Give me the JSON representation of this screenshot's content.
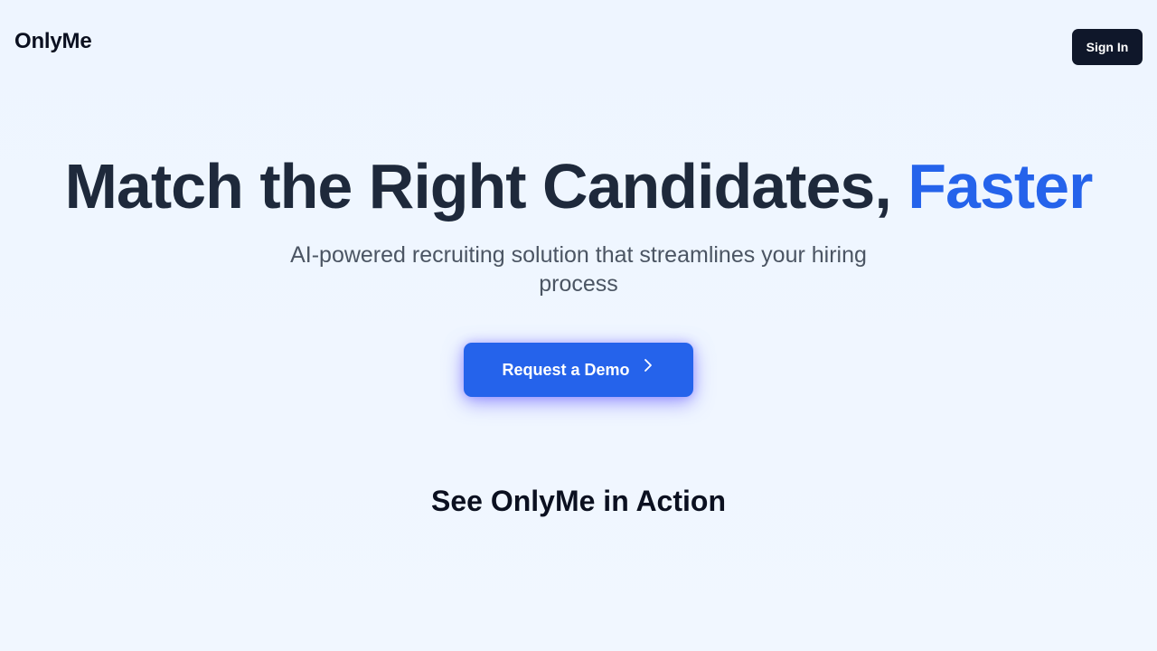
{
  "header": {
    "logo": "OnlyMe",
    "signin_label": "Sign In"
  },
  "hero": {
    "title_main": "Match the Right Candidates, ",
    "title_accent": "Faster",
    "subtitle": "AI-powered recruiting solution that streamlines your hiring process",
    "cta_label": "Request a Demo",
    "cta_icon": "chevron-right-icon"
  },
  "section": {
    "title": "See OnlyMe in Action"
  },
  "colors": {
    "accent": "#2563eb",
    "dark": "#0f172a",
    "background": "#eff6ff"
  }
}
